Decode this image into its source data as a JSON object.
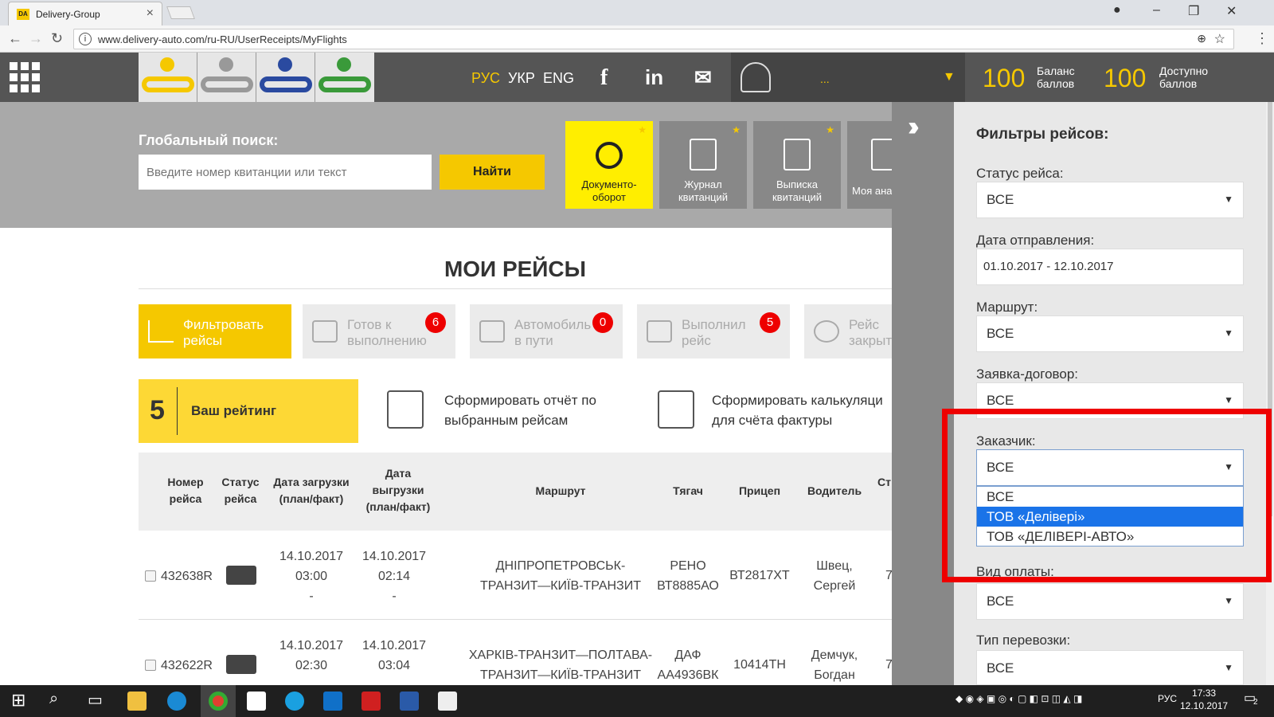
{
  "browser": {
    "tab_title": "Delivery-Group",
    "tab_favicon": "DA",
    "url": "www.delivery-auto.com/ru-RU/UserReceipts/MyFlights"
  },
  "header": {
    "languages": [
      "РУС",
      "УКР",
      "ENG"
    ],
    "active_language": "РУС",
    "username": "...",
    "balance_value": "100",
    "balance_label": "Баланс баллов",
    "available_value": "100",
    "available_label": "Доступно баллов"
  },
  "search": {
    "label": "Глобальный поиск:",
    "placeholder": "Введите номер квитанции или текст",
    "button": "Найти"
  },
  "tiles": [
    {
      "label": "Документо-оборот"
    },
    {
      "label": "Журнал квитанций"
    },
    {
      "label": "Выписка квитанций"
    },
    {
      "label": "Моя ана"
    }
  ],
  "page_title": "МОИ РЕЙСЫ",
  "filter_buttons": [
    {
      "label": "Фильтровать рейсы",
      "badge": ""
    },
    {
      "label": "Готов к выполнению",
      "badge": "6"
    },
    {
      "label": "Автомобиль в пути",
      "badge": "0"
    },
    {
      "label": "Выполнил рейс",
      "badge": "5"
    },
    {
      "label": "Рейс закрыт",
      "badge": ""
    }
  ],
  "rating": {
    "value": "5",
    "label": "Ваш рейтинг"
  },
  "actions": [
    {
      "label": "Сформировать отчёт по выбранным рейсам"
    },
    {
      "label": "Сформировать калькуляци для счёта фактуры"
    }
  ],
  "table": {
    "headers": [
      "Номер рейса",
      "Статус рейса",
      "Дата загрузки (план/факт)",
      "Дата выгрузки (план/факт)",
      "Маршрут",
      "Тягач",
      "Прицеп",
      "Водитель",
      "Ст"
    ],
    "rows": [
      {
        "number": "432638R",
        "load_date": "14.10.2017",
        "load_time": "03:00",
        "load_fact": "-",
        "unload_date": "14.10.2017",
        "unload_time": "02:14",
        "unload_fact": "-",
        "route_1": "ДНІПРОПЕТРОВСЬК-",
        "route_2": "ТРАНЗИТ—КИЇВ-ТРАНЗИТ",
        "tractor_1": "РЕНО",
        "tractor_2": "ВТ8885АО",
        "trailer": "ВТ2817ХТ",
        "driver_1": "Швец,",
        "driver_2": "Сергей",
        "extra": "7"
      },
      {
        "number": "432622R",
        "load_date": "14.10.2017",
        "load_time": "02:30",
        "load_fact": "",
        "unload_date": "14.10.2017",
        "unload_time": "03:04",
        "unload_fact": "",
        "route_1": "ХАРКІВ-ТРАНЗИТ—ПОЛТАВА-",
        "route_2": "ТРАНЗИТ—КИЇВ-ТРАНЗИТ",
        "tractor_1": "ДАФ",
        "tractor_2": "АА4936ВК",
        "trailer": "10414ТН",
        "driver_1": "Демчук,",
        "driver_2": "Богдан",
        "extra": "7"
      }
    ]
  },
  "panel": {
    "title": "Фильтры рейсов:",
    "status_label": "Статус рейса:",
    "status_value": "ВСЕ",
    "date_label": "Дата отправления:",
    "date_value": "01.10.2017 - 12.10.2017",
    "route_label": "Маршрут:",
    "route_value": "ВСЕ",
    "contract_label": "Заявка-договор:",
    "contract_value": "ВСЕ",
    "customer_label": "Заказчик:",
    "customer_value": "ВСЕ",
    "customer_options": [
      "ВСЕ",
      "ТОВ «Делівері»",
      "ТОВ «ДЕЛІВЕРІ-АВТО»"
    ],
    "customer_highlighted": "ТОВ «Делівері»",
    "payment_label": "Вид оплаты:",
    "payment_value": "ВСЕ",
    "transport_label": "Тип перевозки:",
    "transport_value": "ВСЕ"
  },
  "taskbar": {
    "lang": "РУС",
    "time": "17:33",
    "date": "12.10.2017",
    "notif": "2"
  },
  "colors": {
    "accent": "#f5c800",
    "header_bg": "#555555",
    "highlight_red": "#e00000",
    "selected_option": "#1a73e8"
  }
}
